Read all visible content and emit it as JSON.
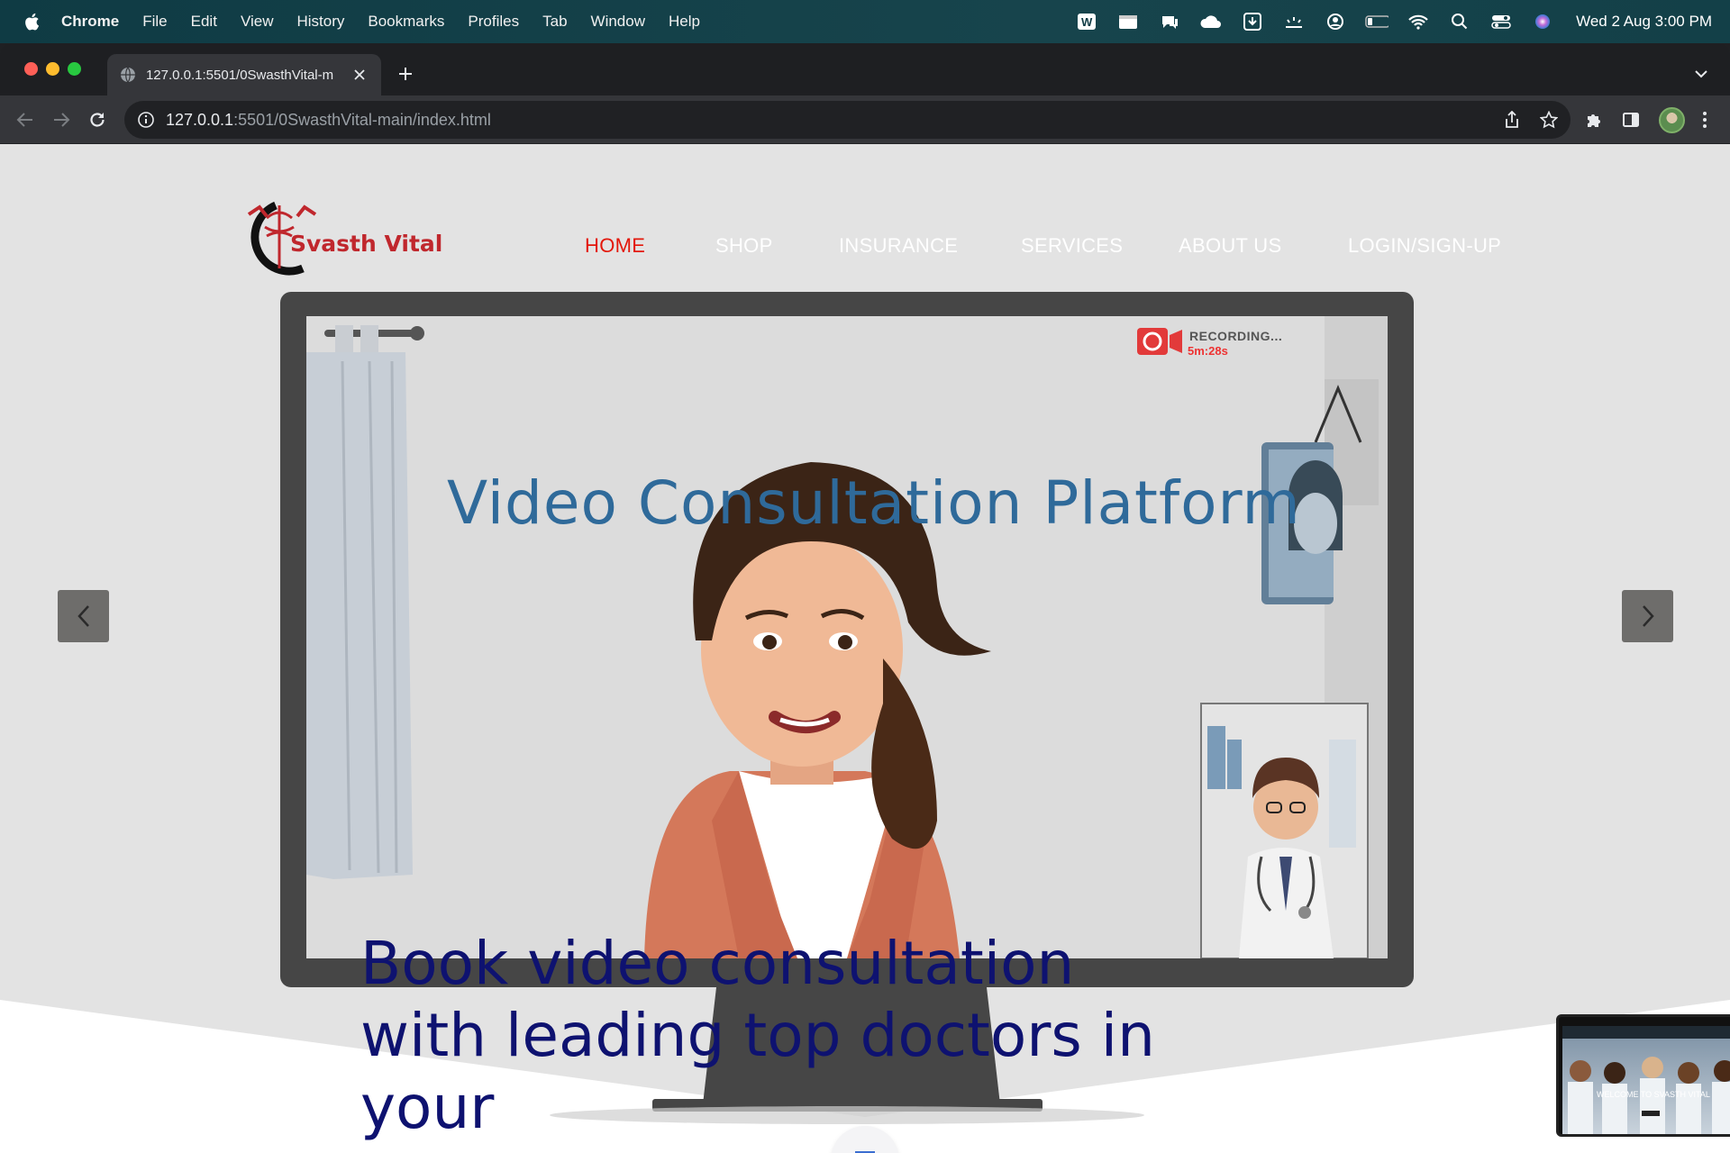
{
  "menubar": {
    "app_name": "Chrome",
    "items": [
      "File",
      "Edit",
      "View",
      "History",
      "Bookmarks",
      "Profiles",
      "Tab",
      "Window",
      "Help"
    ],
    "clock": "Wed 2 Aug  3:00 PM"
  },
  "browser": {
    "tab_title": "127.0.0.1:5501/0SwasthVital-m",
    "url_host": "127.0.0.1",
    "url_path": ":5501/0SwasthVital-main/index.html"
  },
  "site": {
    "logo_text": "Svasth Vital",
    "nav": [
      {
        "label": "HOME",
        "active": true
      },
      {
        "label": "SHOP",
        "active": false
      },
      {
        "label": "INSURANCE",
        "active": false
      },
      {
        "label": "SERVICES",
        "active": false
      },
      {
        "label": "ABOUT US",
        "active": false
      },
      {
        "label": "LOGIN/SIGN-UP",
        "active": false
      }
    ],
    "hero": {
      "title": "Video Consultation Platform",
      "caption": "Book video consultation with leading top doctors in your",
      "recording_label": "RECORDING...",
      "recording_time": "5m:28s"
    },
    "pip_caption": "WELCOME TO SVASTH VITAL"
  },
  "colors": {
    "nav_active": "#e3170a",
    "hero_title": "#2f6a9a",
    "hero_caption": "#0e1270",
    "logo": "#c0272d"
  }
}
